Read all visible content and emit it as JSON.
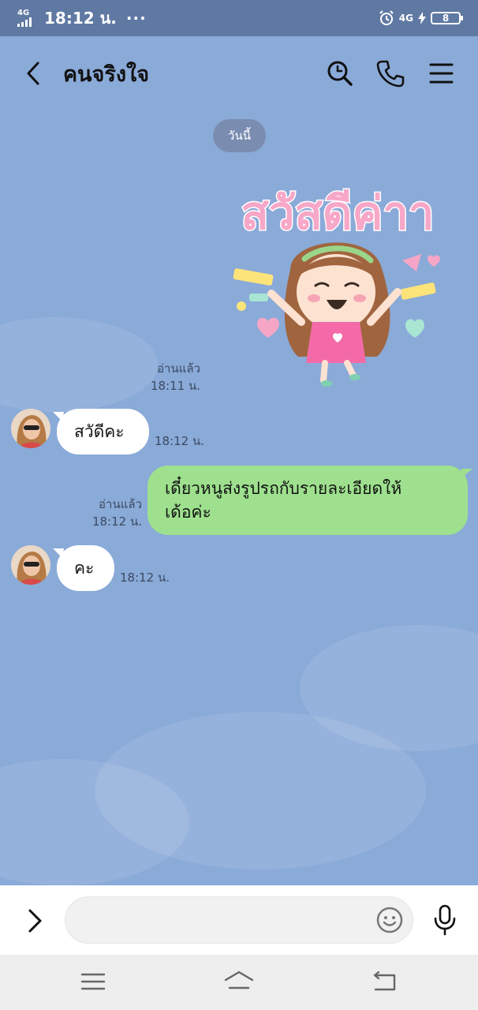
{
  "status_bar": {
    "network": "4G",
    "time": "18:12 น.",
    "dots": "···",
    "network_right": "4G",
    "battery": "8"
  },
  "header": {
    "title": "คนจริงใจ"
  },
  "chat": {
    "date_label": "วันนี้",
    "messages": [
      {
        "type": "sticker",
        "side": "right",
        "status": "อ่านแล้ว",
        "time": "18:11 น.",
        "sticker_text": "สวัสดีค่าา"
      },
      {
        "type": "text",
        "side": "left",
        "text": "สวัดีคะ",
        "time": "18:12 น."
      },
      {
        "type": "text",
        "side": "right",
        "lines": [
          "เดี๋ยวหนูส่งรูปรถกับรายละเอียดให้",
          "เด้อค่ะ"
        ],
        "status": "อ่านแล้ว",
        "time": "18:12 น."
      },
      {
        "type": "text",
        "side": "left",
        "text": "คะ",
        "time": "18:12 น."
      }
    ]
  },
  "input": {
    "placeholder": "",
    "value": ""
  },
  "colors": {
    "chat_background": "#8aaad8",
    "status_bar": "#5f79a3",
    "outgoing_bubble": "#9ee08e",
    "incoming_bubble": "#ffffff"
  },
  "icons": [
    "back-arrow-icon",
    "search-icon",
    "phone-icon",
    "menu-icon",
    "chevron-right-icon",
    "emoji-icon",
    "microphone-icon",
    "nav-menu-icon",
    "nav-home-icon",
    "nav-back-icon"
  ]
}
